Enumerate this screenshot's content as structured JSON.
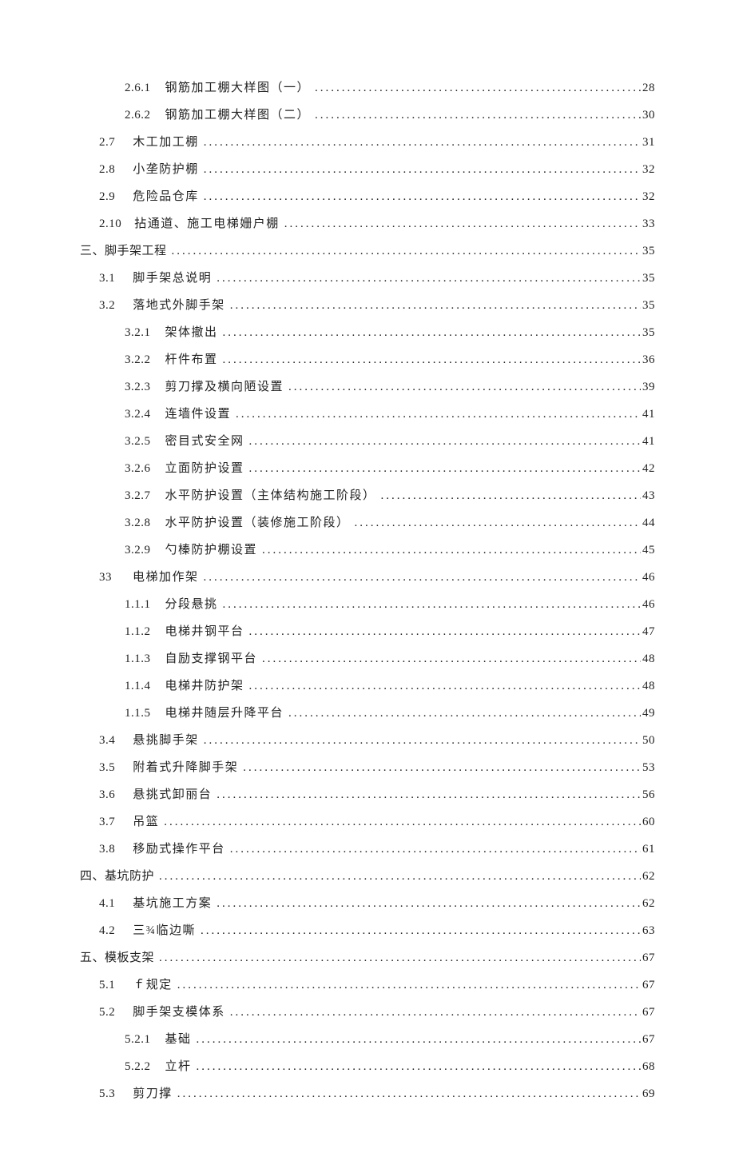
{
  "toc": [
    {
      "level": 2,
      "num": "2.6.1",
      "gap": 18,
      "title": "钢筋加工棚大样图（一）",
      "page": "28"
    },
    {
      "level": 2,
      "num": "2.6.2",
      "gap": 18,
      "title": "钢筋加工棚大样图（二）",
      "page": "30"
    },
    {
      "level": 1,
      "num": "2.7",
      "gap": 22,
      "title": "木工加工棚",
      "page": "31"
    },
    {
      "level": 1,
      "num": "2.8",
      "gap": 22,
      "title": "小垄防护棚",
      "page": "32"
    },
    {
      "level": 1,
      "num": "2.9",
      "gap": 22,
      "title": "危险品仓库",
      "page": "32"
    },
    {
      "level": 1,
      "num": "2.10",
      "gap": 16,
      "title": "拈通道、施工电梯姗户棚",
      "page": "33"
    },
    {
      "level": 0,
      "num": "三、脚手架工程",
      "gap": 0,
      "title": "",
      "page": "35"
    },
    {
      "level": 1,
      "num": "3.1",
      "gap": 22,
      "title": "脚手架总说明",
      "page": "35"
    },
    {
      "level": 1,
      "num": "3.2",
      "gap": 22,
      "title": "落地式外脚手架",
      "page": "35"
    },
    {
      "level": 2,
      "num": "3.2.1",
      "gap": 18,
      "title": "架体撤出",
      "page": "35"
    },
    {
      "level": 2,
      "num": "3.2.2",
      "gap": 18,
      "title": "杆件布置",
      "page": "36"
    },
    {
      "level": 2,
      "num": "3.2.3",
      "gap": 18,
      "title": "剪刀撑及横向陋设置",
      "page": "39"
    },
    {
      "level": 2,
      "num": "3.2.4",
      "gap": 18,
      "title": "连墙件设置",
      "page": "41"
    },
    {
      "level": 2,
      "num": "3.2.5",
      "gap": 18,
      "title": "密目式安全网",
      "page": "41"
    },
    {
      "level": 2,
      "num": "3.2.6",
      "gap": 18,
      "title": "立面防护设置",
      "page": "42"
    },
    {
      "level": 2,
      "num": "3.2.7",
      "gap": 18,
      "title": "水平防护设置（主体结构施工阶段）",
      "page": "43"
    },
    {
      "level": 2,
      "num": "3.2.8",
      "gap": 18,
      "title": "水平防护设置（装修施工阶段）",
      "page": "44"
    },
    {
      "level": 2,
      "num": "3.2.9",
      "gap": 18,
      "title": "勺榛防护棚设置",
      "page": "45"
    },
    {
      "level": 1,
      "num": "33",
      "gap": 26,
      "title": "电梯加作架",
      "page": "46"
    },
    {
      "level": 2,
      "num": "1.1.1",
      "gap": 18,
      "title": "分段悬挑",
      "page": "46"
    },
    {
      "level": 2,
      "num": "1.1.2",
      "gap": 18,
      "title": "电梯井钢平台",
      "page": "47"
    },
    {
      "level": 2,
      "num": "1.1.3",
      "gap": 18,
      "title": "自励支撑钢平台",
      "page": "48"
    },
    {
      "level": 2,
      "num": "1.1.4",
      "gap": 18,
      "title": "电梯井防护架",
      "page": "48"
    },
    {
      "level": 2,
      "num": "1.1.5",
      "gap": 18,
      "title": "电梯井随层升降平台",
      "page": "49"
    },
    {
      "level": 1,
      "num": "3.4",
      "gap": 22,
      "title": "悬挑脚手架",
      "page": "50"
    },
    {
      "level": 1,
      "num": "3.5",
      "gap": 22,
      "title": "附着式升降脚手架",
      "page": "53"
    },
    {
      "level": 1,
      "num": "3.6",
      "gap": 22,
      "title": "悬挑式卸丽台",
      "page": "56"
    },
    {
      "level": 1,
      "num": "3.7",
      "gap": 22,
      "title": "吊篮",
      "page": "60"
    },
    {
      "level": 1,
      "num": "3.8",
      "gap": 22,
      "title": "移励式操作平台",
      "page": "61"
    },
    {
      "level": 0,
      "num": "四、基坑防护",
      "gap": 0,
      "title": "",
      "page": "62"
    },
    {
      "level": 1,
      "num": "4.1",
      "gap": 22,
      "title": "基坑施工方案",
      "page": "62"
    },
    {
      "level": 1,
      "num": "4.2",
      "gap": 22,
      "title": "三¾临边嘶",
      "page": "63"
    },
    {
      "level": 0,
      "num": "五、模板支架",
      "gap": 0,
      "title": "",
      "page": "67"
    },
    {
      "level": 1,
      "num": "5.1",
      "gap": 22,
      "title": "ｆ规定",
      "page": "67"
    },
    {
      "level": 1,
      "num": "5.2",
      "gap": 22,
      "title": "脚手架支模体系",
      "page": "67"
    },
    {
      "level": 2,
      "num": "5.2.1",
      "gap": 18,
      "title": "基础",
      "page": "67"
    },
    {
      "level": 2,
      "num": "5.2.2",
      "gap": 18,
      "title": "立杆",
      "page": "68"
    },
    {
      "level": 1,
      "num": "5.3",
      "gap": 22,
      "title": "剪刀撑",
      "page": "69"
    }
  ]
}
